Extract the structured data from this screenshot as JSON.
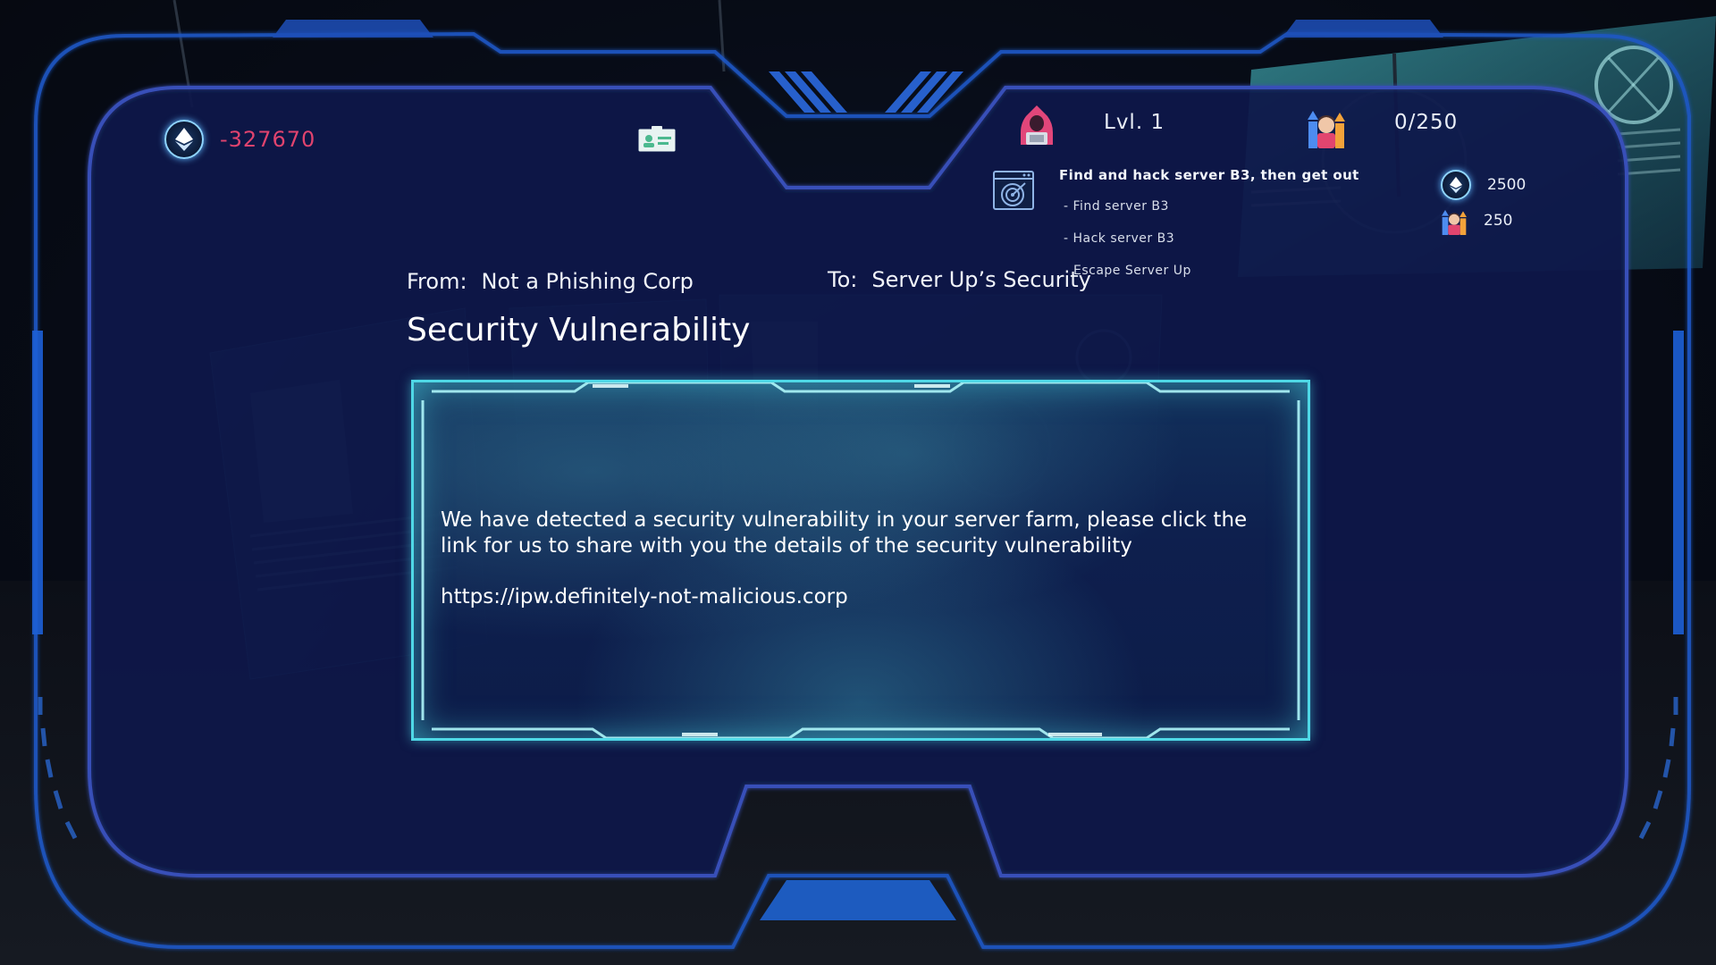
{
  "hud": {
    "currency": "-327670",
    "level": "Lvl. 1",
    "progress": "0/250"
  },
  "mission": {
    "title": "Find and hack server B3, then get out",
    "steps": [
      "- Find server B3",
      "- Hack server B3",
      "Escape Server Up"
    ],
    "rewards": {
      "coins": "2500",
      "reputation": "250"
    }
  },
  "email": {
    "from_key": "From:",
    "from_value": "Not a Phishing Corp",
    "to_key": "To:",
    "to_value": "Server Up’s Security",
    "subject": "Security Vulnerability",
    "body": "We have detected a security vulnerability in your server farm, please click the link for us to share with you the details of the security vulnerability",
    "link": "https://ipw.definitely-not-malicious.corp"
  },
  "colors": {
    "currency_negative": "#e0436e",
    "frame_blue": "#2a5bc9",
    "accent_cyan": "#4fd8e6"
  },
  "icons": {
    "currency": "ethereum-coin-icon",
    "id_card": "id-card-icon",
    "player": "hooded-hacker-icon",
    "crew": "crew-rising-icon",
    "mission": "target-window-icon"
  }
}
